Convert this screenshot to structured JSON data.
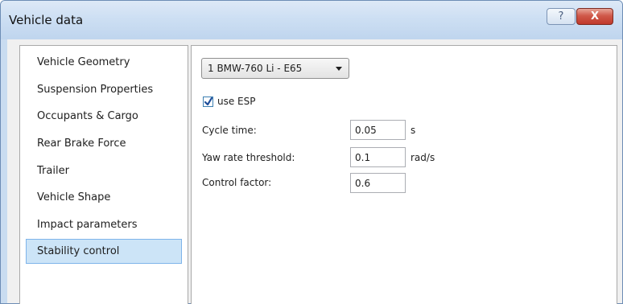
{
  "window": {
    "title": "Vehicle data",
    "help_glyph": "?",
    "close_glyph": "X"
  },
  "sidebar": {
    "items": [
      {
        "label": "Vehicle Geometry"
      },
      {
        "label": "Suspension Properties"
      },
      {
        "label": "Occupants & Cargo"
      },
      {
        "label": "Rear Brake Force"
      },
      {
        "label": "Trailer"
      },
      {
        "label": "Vehicle Shape"
      },
      {
        "label": "Impact parameters"
      },
      {
        "label": "Stability control",
        "selected": true
      }
    ]
  },
  "panel": {
    "vehicle_select": "1 BMW-760 Li - E65",
    "esp": {
      "label": "use ESP",
      "checked": true
    },
    "fields": [
      {
        "label": "Cycle time:",
        "value": "0.05",
        "unit": "s"
      },
      {
        "label": "Yaw rate threshold:",
        "value": "0.1",
        "unit": "rad/s"
      },
      {
        "label": "Control factor:",
        "value": "0.6",
        "unit": ""
      }
    ]
  },
  "colors": {
    "titlebar": "#c9dcf0",
    "selection_bg": "#cce4f7",
    "selection_border": "#7eb4ea",
    "close_button": "#c0392b"
  },
  "icons": {
    "help": "help-icon",
    "close": "close-icon",
    "dropdown": "chevron-down-icon",
    "check": "checkmark-icon"
  }
}
